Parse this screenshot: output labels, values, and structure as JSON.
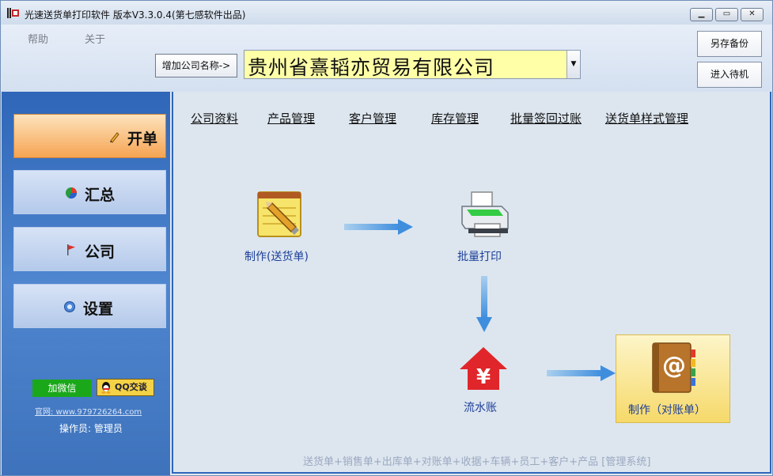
{
  "window": {
    "title": "光速送货单打印软件 版本V3.3.0.4(第七感软件出品)",
    "controls": [
      "minimize",
      "maximize",
      "close"
    ]
  },
  "menu": {
    "help": "帮助",
    "about": "关于"
  },
  "company_bar": {
    "add_button": "增加公司名称->",
    "selected_company": "贵州省熹韬亦贸易有限公司"
  },
  "right_buttons": {
    "backup": "另存备份",
    "standby": "进入待机"
  },
  "sidebar": {
    "items": [
      {
        "label": "开单",
        "icon": "pencil-icon",
        "active": true
      },
      {
        "label": "汇总",
        "icon": "pie-chart-icon",
        "active": false
      },
      {
        "label": "公司",
        "icon": "flag-icon",
        "active": false
      },
      {
        "label": "设置",
        "icon": "gear-icon",
        "active": false
      }
    ],
    "wechat_button": "加微信",
    "qq_button": "QQ交谈",
    "website": "官网: www.979726264.com",
    "operator": "操作员: 管理员"
  },
  "top_links": [
    "公司资料",
    "产品管理",
    "客户管理",
    "库存管理",
    "批量签回过账",
    "送货单样式管理"
  ],
  "flow": {
    "make_delivery": "制作(送货单)",
    "batch_print": "批量打印",
    "cash_flow": "流水账",
    "make_statement": "制作（对账单）"
  },
  "footer": "送货单+销售单+出库单+对账单+收据+车辆+员工+客户+产品 [管理系统]",
  "colors": {
    "sidebar_blue": "#3b72c0",
    "active_orange": "#f6a452",
    "flow_label_blue": "#1d3f99",
    "company_field_yellow": "#ffffa8"
  }
}
